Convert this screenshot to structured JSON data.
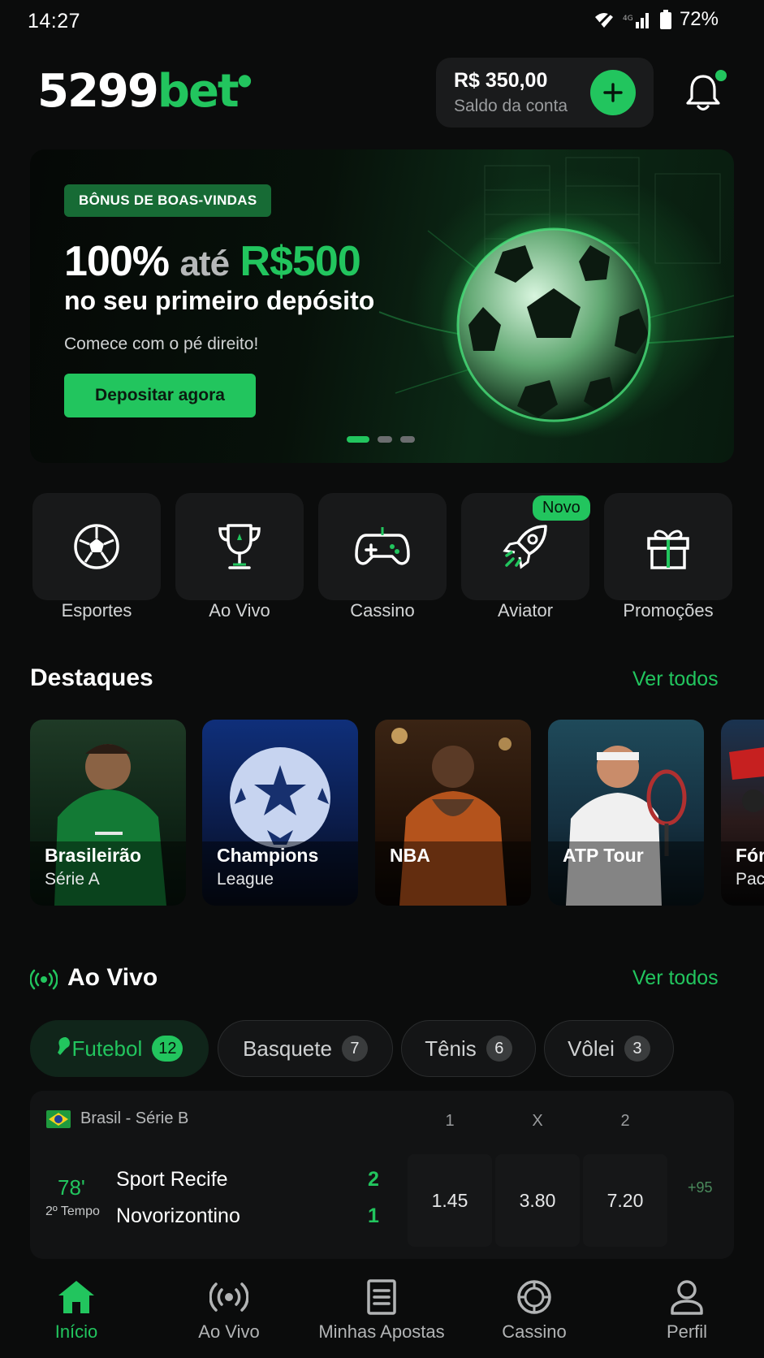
{
  "status_bar": {
    "time": "14:27",
    "battery": "72%"
  },
  "header": {
    "logo_main": "5299",
    "logo_accent": "bet",
    "balance_amount": "R$ 350,00",
    "balance_label": "Saldo da conta"
  },
  "banner": {
    "tag": "BÔNUS DE BOAS-VINDAS",
    "title_percent": "100%",
    "title_ate": "até",
    "title_amount": "R$500",
    "subtitle": "no seu primeiro depósito",
    "description": "Comece com o pé direito!",
    "cta": "Depositar agora",
    "slide_count": 3,
    "active_slide": 1
  },
  "categories": [
    {
      "label": "Esportes",
      "icon": "soccer-ball-icon"
    },
    {
      "label": "Ao Vivo",
      "icon": "trophy-icon"
    },
    {
      "label": "Cassino",
      "icon": "gamepad-icon"
    },
    {
      "label": "Aviator",
      "icon": "rocket-icon",
      "badge": "Novo"
    },
    {
      "label": "Promoções",
      "icon": "gift-icon"
    }
  ],
  "highlights": {
    "title": "Destaques",
    "see_all": "Ver todos",
    "items": [
      {
        "title": "Brasileirão",
        "subtitle": "Série A"
      },
      {
        "title": "Champions",
        "subtitle": "League"
      },
      {
        "title": "NBA",
        "subtitle": ""
      },
      {
        "title": "ATP Tour",
        "subtitle": ""
      },
      {
        "title": "Fór",
        "subtitle": "Pac"
      }
    ]
  },
  "live": {
    "title": "Ao Vivo",
    "see_all": "Ver todos",
    "tabs": [
      {
        "label": "Futebol",
        "count": "12"
      },
      {
        "label": "Basquete",
        "count": "7"
      },
      {
        "label": "Tênis",
        "count": "6"
      },
      {
        "label": "Vôlei",
        "count": "3"
      }
    ],
    "match": {
      "league": "Brasil - Série B",
      "odd_headers": [
        "1",
        "X",
        "2"
      ],
      "minute": "78'",
      "period": "2º Tempo",
      "home_team": "Sport Recife",
      "away_team": "Novorizontino",
      "home_score": "2",
      "away_score": "1",
      "odds": [
        "1.45",
        "3.80",
        "7.20"
      ],
      "more_markets": "+95"
    }
  },
  "bottom_nav": [
    {
      "label": "Início",
      "icon": "home-icon",
      "active": true
    },
    {
      "label": "Ao Vivo",
      "icon": "live-icon"
    },
    {
      "label": "Minhas Apostas",
      "icon": "bets-icon"
    },
    {
      "label": "Cassino",
      "icon": "casino-chip-icon"
    },
    {
      "label": "Perfil",
      "icon": "profile-icon"
    }
  ],
  "colors": {
    "accent": "#22c55e",
    "background": "#0b0c0c",
    "card": "#18191a"
  }
}
